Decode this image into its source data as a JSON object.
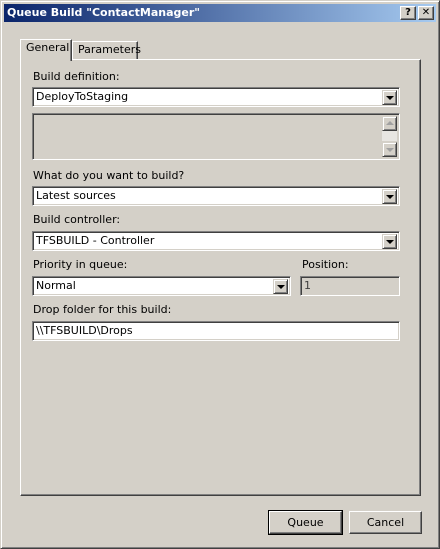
{
  "window": {
    "title": "Queue Build \"ContactManager\"",
    "help_label": "?",
    "close_label": "✕"
  },
  "tabs": [
    {
      "label": "General",
      "active": true
    },
    {
      "label": "Parameters",
      "active": false
    }
  ],
  "form": {
    "build_definition": {
      "label": "Build definition:",
      "value": "DeployToStaging",
      "description": ""
    },
    "what_to_build": {
      "label": "What do you want to build?",
      "value": "Latest sources"
    },
    "build_controller": {
      "label": "Build controller:",
      "value": "TFSBUILD - Controller"
    },
    "priority": {
      "label": "Priority in queue:",
      "value": "Normal"
    },
    "position": {
      "label": "Position:",
      "value": "1"
    },
    "drop_folder": {
      "label": "Drop folder for this build:",
      "value": "\\\\TFSBUILD\\Drops"
    }
  },
  "buttons": {
    "queue": "Queue",
    "cancel": "Cancel"
  },
  "colors": {
    "titlebar_start": "#0a246a",
    "titlebar_end": "#a6caf0",
    "dialog_bg": "#d4d0c8"
  },
  "icons": [
    "help-icon",
    "close-icon",
    "chevron-down-icon",
    "scroll-up-icon",
    "scroll-down-icon"
  ]
}
